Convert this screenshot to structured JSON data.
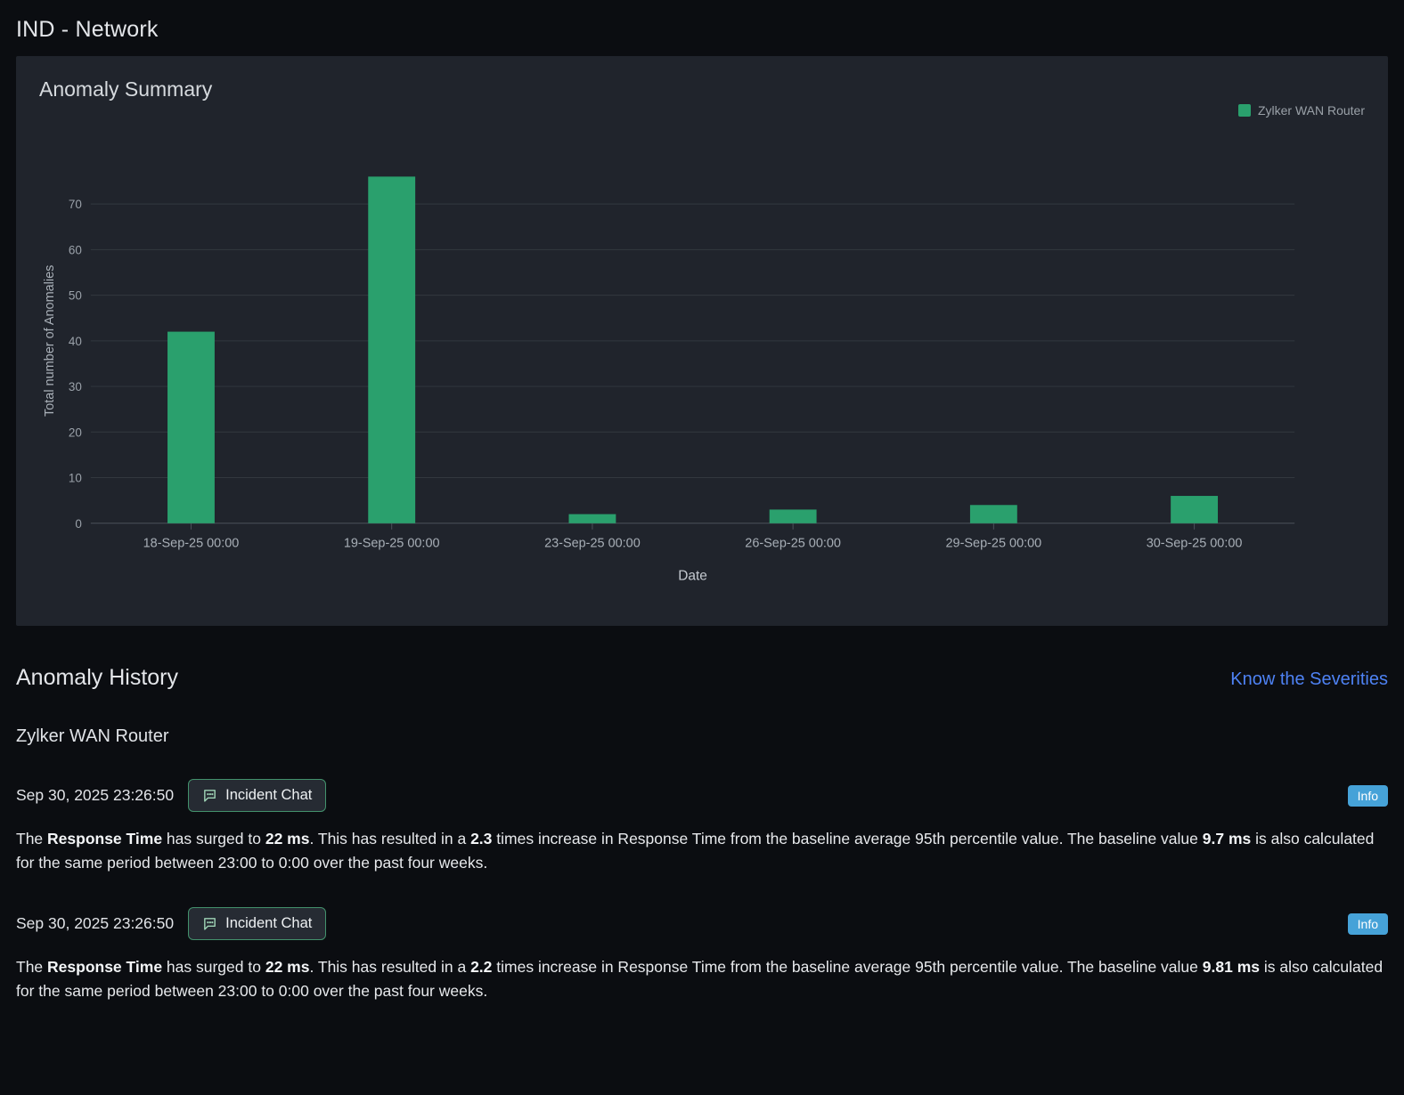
{
  "page": {
    "title": "IND - Network"
  },
  "chart_data": {
    "type": "bar",
    "title": "Anomaly Summary",
    "categories": [
      "18-Sep-25 00:00",
      "19-Sep-25 00:00",
      "23-Sep-25 00:00",
      "26-Sep-25 00:00",
      "29-Sep-25 00:00",
      "30-Sep-25 00:00"
    ],
    "series": [
      {
        "name": "Zylker WAN Router",
        "values": [
          42,
          76,
          2,
          3,
          4,
          6
        ],
        "color": "#2aa06d"
      }
    ],
    "xlabel": "Date",
    "ylabel": "Total number of Anomalies",
    "ylim": [
      0,
      80
    ],
    "yticks": [
      0,
      10,
      20,
      30,
      40,
      50,
      60,
      70
    ],
    "grid": true,
    "legend_position": "top-right"
  },
  "history": {
    "title": "Anomaly History",
    "link": "Know the Severities",
    "device": "Zylker WAN Router",
    "entries": [
      {
        "timestamp": "Sep 30, 2025 23:26:50",
        "chat_button_label": "Incident Chat",
        "severity": "Info",
        "message": [
          {
            "text": "The ",
            "bold": false
          },
          {
            "text": "Response Time",
            "bold": true
          },
          {
            "text": " has surged to ",
            "bold": false
          },
          {
            "text": "22 ms",
            "bold": true
          },
          {
            "text": ". This has resulted in a ",
            "bold": false
          },
          {
            "text": "2.3",
            "bold": true
          },
          {
            "text": " times increase in Response Time from the baseline average 95th percentile value. The baseline value ",
            "bold": false
          },
          {
            "text": "9.7 ms",
            "bold": true
          },
          {
            "text": " is also calculated for the same period between 23:00 to 0:00 over the past four weeks.",
            "bold": false
          }
        ]
      },
      {
        "timestamp": "Sep 30, 2025 23:26:50",
        "chat_button_label": "Incident Chat",
        "severity": "Info",
        "message": [
          {
            "text": "The ",
            "bold": false
          },
          {
            "text": "Response Time",
            "bold": true
          },
          {
            "text": " has surged to ",
            "bold": false
          },
          {
            "text": "22 ms",
            "bold": true
          },
          {
            "text": ". This has resulted in a ",
            "bold": false
          },
          {
            "text": "2.2",
            "bold": true
          },
          {
            "text": " times increase in Response Time from the baseline average 95th percentile value. The baseline value ",
            "bold": false
          },
          {
            "text": "9.81 ms",
            "bold": true
          },
          {
            "text": " is also calculated for the same period between 23:00 to 0:00 over the past four weeks.",
            "bold": false
          }
        ]
      }
    ]
  },
  "colors": {
    "bar": "#2aa06d",
    "link": "#4e82f4",
    "info_badge": "#46a2d8",
    "panel_bg": "#20242c",
    "page_bg": "#0b0d11"
  }
}
